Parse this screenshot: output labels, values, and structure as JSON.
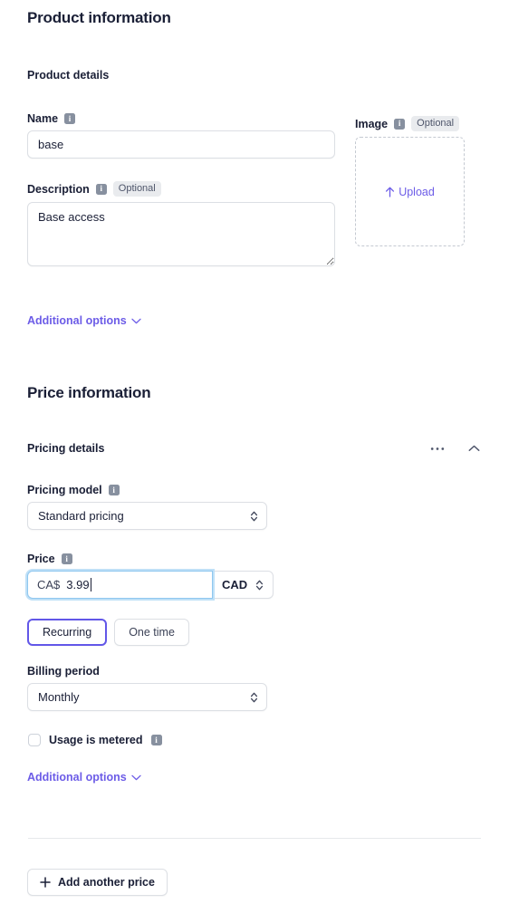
{
  "product_section": {
    "title": "Product information",
    "subsection_title": "Product details",
    "name_field": {
      "label": "Name",
      "info_icon": "info-icon",
      "value": "base",
      "placeholder": ""
    },
    "description_field": {
      "label": "Description",
      "info_icon": "info-icon",
      "badge": "Optional",
      "value": "Base access",
      "placeholder": ""
    },
    "image_field": {
      "label": "Image",
      "info_icon": "info-icon",
      "badge": "Optional",
      "upload_label": "Upload",
      "upload_icon": "upload-arrow-icon"
    },
    "additional_options": {
      "label": "Additional options",
      "chevron_icon": "chevron-down-icon"
    }
  },
  "price_section": {
    "title": "Price information",
    "subsection_title": "Pricing details",
    "more_icon": "ellipsis-icon",
    "collapse_icon": "chevron-up-icon",
    "pricing_model_field": {
      "label": "Pricing model",
      "info_icon": "info-icon",
      "value": "Standard pricing",
      "options": [
        "Standard pricing"
      ],
      "chevron_icon": "chevron-updown-icon"
    },
    "price_field": {
      "label": "Price",
      "info_icon": "info-icon",
      "currency_prefix": "CA$",
      "value": "3.99",
      "currency_value": "CAD",
      "currency_options": [
        "CAD"
      ],
      "chevron_icon": "chevron-updown-icon"
    },
    "billing_type": {
      "options": [
        {
          "label": "Recurring",
          "selected": true
        },
        {
          "label": "One time",
          "selected": false
        }
      ]
    },
    "billing_period_field": {
      "label": "Billing period",
      "value": "Monthly",
      "options": [
        "Monthly"
      ],
      "chevron_icon": "chevron-updown-icon"
    },
    "usage_metered": {
      "label": "Usage is metered",
      "info_icon": "info-icon",
      "checked": false
    },
    "additional_options": {
      "label": "Additional options",
      "chevron_icon": "chevron-down-icon"
    },
    "add_price_button": {
      "label": "Add another price",
      "plus_icon": "plus-icon"
    }
  },
  "colors": {
    "accent_purple": "#6c5ce7",
    "selected_border": "#6257e8",
    "focus_ring": "#bfe0f7",
    "text_primary": "#1a1f36",
    "border": "#dcdfe4",
    "badge_bg": "#e9ebee",
    "info_icon_bg": "#87909f"
  }
}
